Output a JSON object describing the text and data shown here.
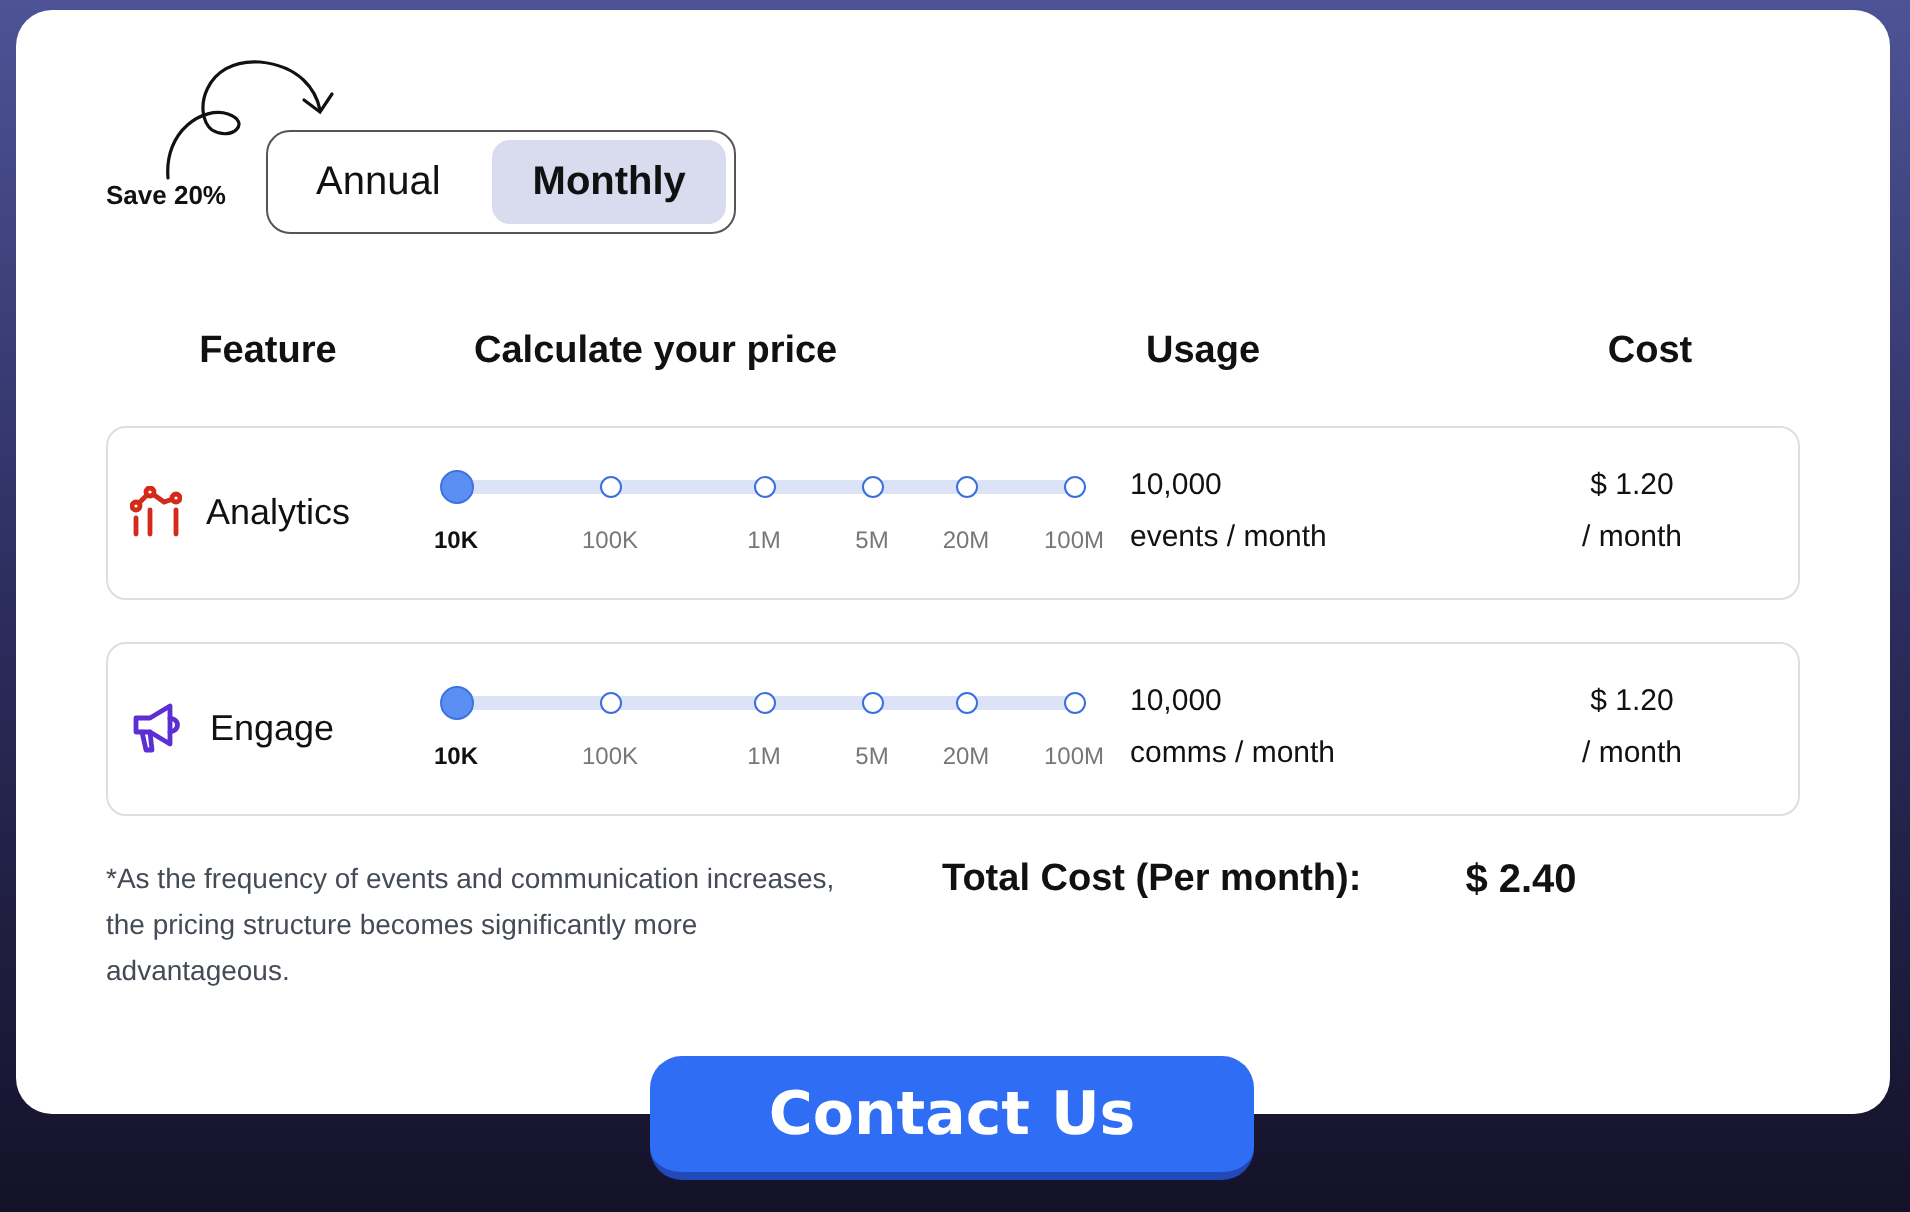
{
  "billing": {
    "note": "Save 20%",
    "options": [
      {
        "label": "Annual",
        "selected": false
      },
      {
        "label": "Monthly",
        "selected": true
      }
    ]
  },
  "columns": [
    "Feature",
    "Calculate your price",
    "Usage",
    "Cost"
  ],
  "features": [
    {
      "name": "Analytics",
      "kind": "analytics",
      "stops": [
        {
          "label": "10K",
          "selected": true
        },
        {
          "label": "100K",
          "selected": false
        },
        {
          "label": "1M",
          "selected": false
        },
        {
          "label": "5M",
          "selected": false
        },
        {
          "label": "20M",
          "selected": false
        },
        {
          "label": "100M",
          "selected": false
        }
      ],
      "usage": "10,000",
      "usage_unit": "events / month",
      "cost": "$ 1.20",
      "cost_unit": "/ month"
    },
    {
      "name": "Engage",
      "kind": "megaphone",
      "stops": [
        {
          "label": "10K",
          "selected": true
        },
        {
          "label": "100K",
          "selected": false
        },
        {
          "label": "1M",
          "selected": false
        },
        {
          "label": "5M",
          "selected": false
        },
        {
          "label": "20M",
          "selected": false
        },
        {
          "label": "100M",
          "selected": false
        }
      ],
      "usage": "10,000",
      "usage_unit": "comms / month",
      "cost": "$ 1.20",
      "cost_unit": "/ month"
    }
  ],
  "footnote": "*As the frequency of events and communication increases, the pricing structure becomes significantly more advantageous.",
  "total": {
    "label": "Total Cost (Per month):",
    "value": "$ 2.40"
  },
  "cta": "Contact Us"
}
